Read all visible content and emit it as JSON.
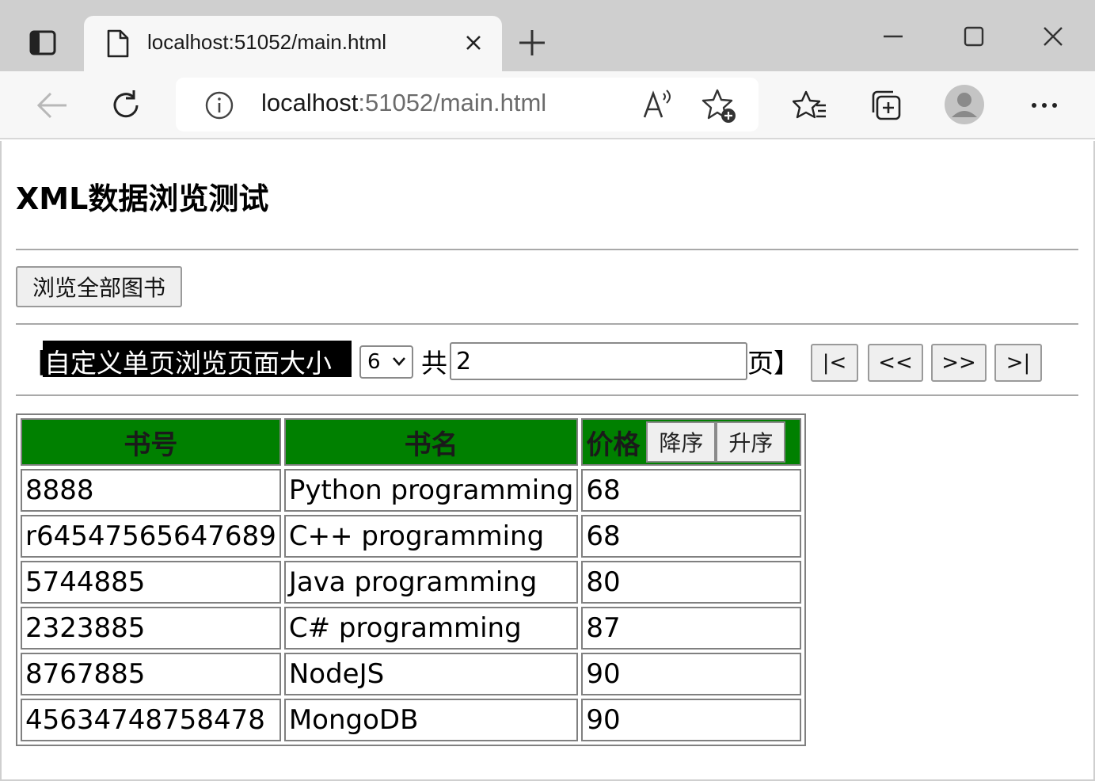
{
  "browser": {
    "tab_title": "localhost:51052/main.html",
    "url_host": "localhost",
    "url_rest": ":51052/main.html"
  },
  "page": {
    "title": "XML数据浏览测试",
    "browse_all_label": "浏览全部图书",
    "pager": {
      "bracket_open": "【",
      "page_size_label": "自定义单页浏览页面大小",
      "page_size_value": "6",
      "total_label": "共",
      "total_pages_value": "2",
      "pages_suffix": "页】",
      "first_label": "|<",
      "prev_label": "<<",
      "next_label": ">>",
      "last_label": ">|"
    },
    "table": {
      "headers": {
        "id": "书号",
        "name": "书名",
        "price": "价格",
        "sort_desc": "降序",
        "sort_asc": "升序"
      },
      "rows": [
        {
          "id": "8888",
          "name": "Python programming",
          "price": "68"
        },
        {
          "id": "r64547565647689",
          "name": "C++ programming",
          "price": "68"
        },
        {
          "id": "5744885",
          "name": "Java programming",
          "price": "80"
        },
        {
          "id": "2323885",
          "name": "C# programming",
          "price": "87"
        },
        {
          "id": "8767885",
          "name": "NodeJS",
          "price": "90"
        },
        {
          "id": "45634748758478",
          "name": "MongoDB",
          "price": "90"
        }
      ]
    }
  },
  "colors": {
    "header_bg": "#008000",
    "tabstrip_bg": "#cfcfcf",
    "toolbar_bg": "#f7f7f7"
  },
  "icons": [
    "tab-actions-icon",
    "page-icon",
    "close-icon",
    "plus-icon",
    "minimize-icon",
    "maximize-icon",
    "back-icon",
    "reload-icon",
    "info-icon",
    "read-aloud-icon",
    "add-favorite-icon",
    "favorites-icon",
    "collections-icon",
    "profile-icon",
    "more-icon",
    "chevron-down-icon"
  ]
}
